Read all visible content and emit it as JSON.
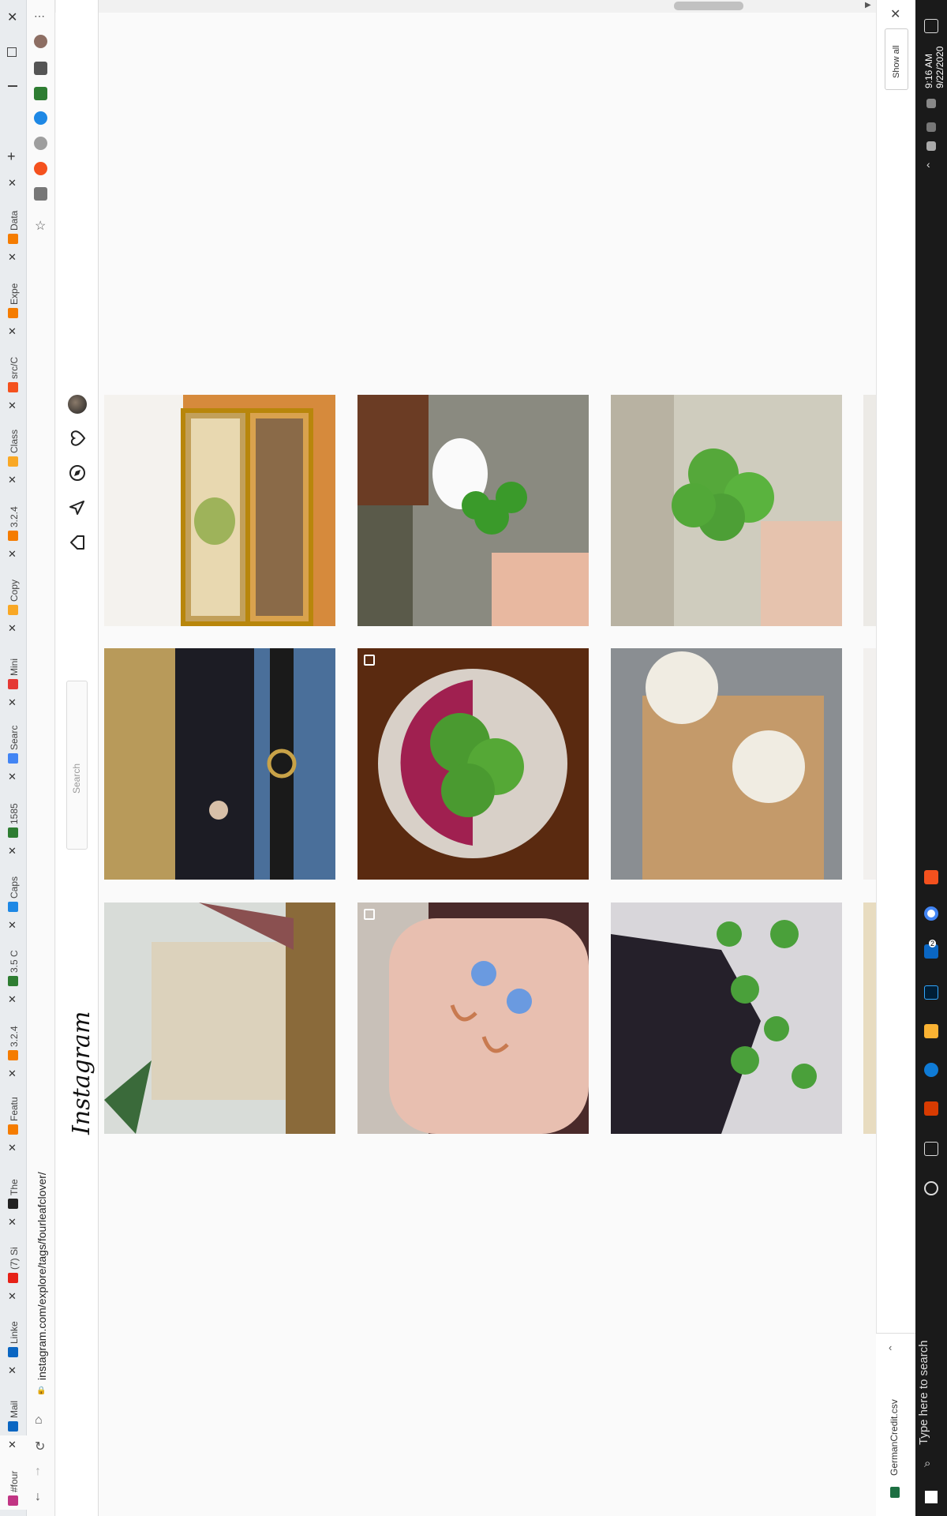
{
  "browser": {
    "url": "instagram.com/explore/tags/fourleafclover/",
    "tabs": [
      {
        "title": "#four",
        "fav": "#c13584"
      },
      {
        "title": "Mail",
        "fav": "#0a66c2"
      },
      {
        "title": "Linke",
        "fav": "#0a66c2"
      },
      {
        "title": "(7) Si",
        "fav": "#e62117"
      },
      {
        "title": "The",
        "fav": "#222222"
      },
      {
        "title": "Featu",
        "fav": "#f57c00"
      },
      {
        "title": "3.2.4",
        "fav": "#f57c00"
      },
      {
        "title": "3.5 C",
        "fav": "#2e7d32"
      },
      {
        "title": "Caps",
        "fav": "#1e88e5"
      },
      {
        "title": "1585",
        "fav": "#2e7d32"
      },
      {
        "title": "Searc",
        "fav": "#4285f4"
      },
      {
        "title": "Mini",
        "fav": "#e53935"
      },
      {
        "title": "Copy",
        "fav": "#f9a825"
      },
      {
        "title": "3.2.4",
        "fav": "#f57c00"
      },
      {
        "title": "Class",
        "fav": "#f9a825"
      },
      {
        "title": "src/C",
        "fav": "#f4511e"
      },
      {
        "title": "Expe",
        "fav": "#f57c00"
      },
      {
        "title": "Data",
        "fav": "#f57c00"
      }
    ],
    "new_tab": "+"
  },
  "instagram": {
    "logo": "Instagram",
    "search_placeholder": "Search"
  },
  "downloads": {
    "file": "GermanCredit.csv",
    "show_all": "Show all"
  },
  "taskbar": {
    "time": "9:16 AM",
    "date": "9/22/2020",
    "search": "Type here to search",
    "badge": "2"
  },
  "colors": {
    "accent": "#0095f6",
    "taskbar": "#1a1a1a"
  }
}
